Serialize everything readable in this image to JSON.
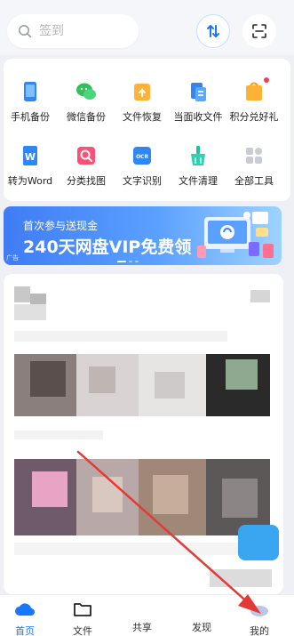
{
  "search": {
    "placeholder": "签到"
  },
  "tools": [
    {
      "label": "手机备份",
      "icon": "phone-backup-icon"
    },
    {
      "label": "微信备份",
      "icon": "wechat-backup-icon"
    },
    {
      "label": "文件恢复",
      "icon": "file-recover-icon"
    },
    {
      "label": "当面收文件",
      "icon": "receive-file-icon"
    },
    {
      "label": "积分兑好礼",
      "icon": "gift-icon"
    },
    {
      "label": "转为Word",
      "icon": "word-icon"
    },
    {
      "label": "分类找图",
      "icon": "image-search-icon"
    },
    {
      "label": "文字识别",
      "icon": "ocr-icon"
    },
    {
      "label": "文件清理",
      "icon": "cleanup-icon"
    },
    {
      "label": "全部工具",
      "icon": "all-tools-icon"
    }
  ],
  "banner": {
    "subtitle": "首次参与送现金",
    "title": "240天网盘VIP免费领",
    "ad_label": "广告"
  },
  "tabs": [
    {
      "label": "首页",
      "icon": "cloud-home-icon",
      "active": true
    },
    {
      "label": "文件",
      "icon": "folder-icon",
      "active": false
    },
    {
      "label": "共享",
      "icon": "share-icon",
      "active": false
    },
    {
      "label": "发现",
      "icon": "discover-icon",
      "active": false
    },
    {
      "label": "我的",
      "icon": "profile-icon",
      "active": false
    }
  ],
  "colors": {
    "accent": "#1677ff",
    "annotation_arrow": "#e53935",
    "badge": "#f53c5c"
  }
}
